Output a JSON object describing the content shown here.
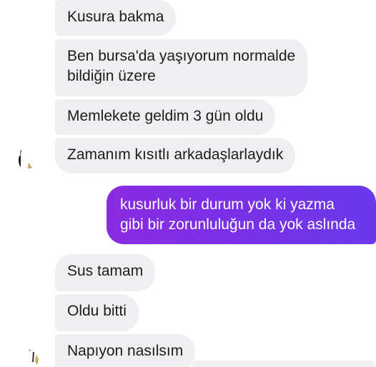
{
  "messages": [
    {
      "direction": "incoming",
      "text": "Kusura bakma"
    },
    {
      "direction": "incoming",
      "lines": [
        "Ben bursa'da yaşıyorum normalde",
        "bildiğin üzere"
      ]
    },
    {
      "direction": "incoming",
      "text": "Memlekete geldim 3 gün oldu"
    },
    {
      "direction": "incoming",
      "text": "Zamanım kısıtlı arkadaşlarlaydık"
    },
    {
      "direction": "outgoing",
      "lines": [
        "kusurluk bir durum yok ki yazma",
        "gibi bir zorunluluğun da yok aslında"
      ]
    },
    {
      "direction": "incoming",
      "text": "Sus tamam"
    },
    {
      "direction": "incoming",
      "text": "Oldu bitti"
    },
    {
      "direction": "incoming",
      "text": "Napıyon nasılsım"
    }
  ],
  "colors": {
    "incoming_bubble": "#efeff1",
    "outgoing_gradient_start": "#8a2be2",
    "outgoing_gradient_end": "#6a39ea",
    "incoming_text": "#1c1c1c",
    "outgoing_text": "#ffffff"
  },
  "icons": {
    "avatar": "contact-avatar-icon"
  }
}
